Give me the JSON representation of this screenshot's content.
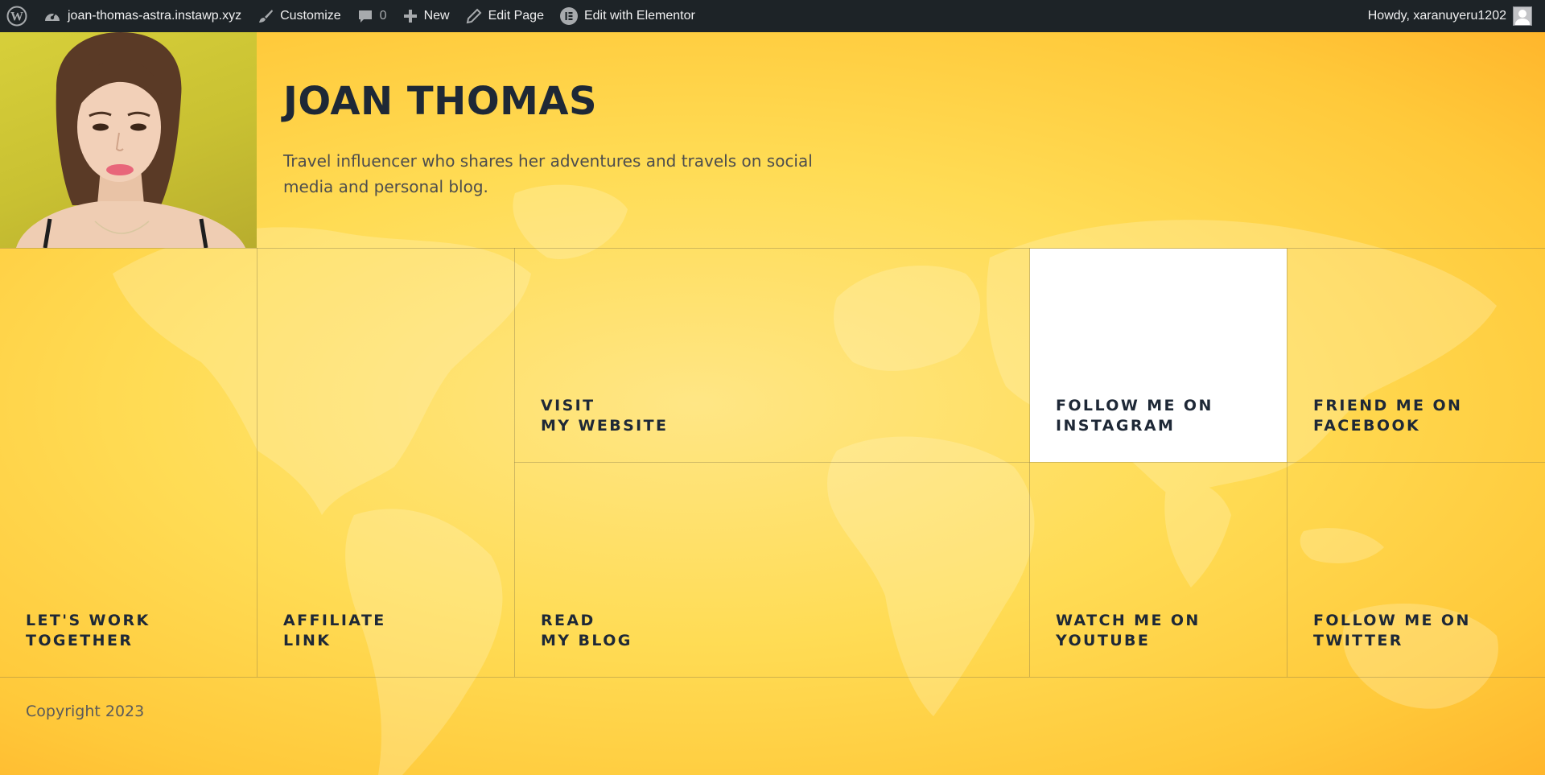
{
  "adminbar": {
    "site_name": "joan-thomas-astra.instawp.xyz",
    "customize": "Customize",
    "comments_count": "0",
    "new": "New",
    "edit_page": "Edit Page",
    "edit_elementor": "Edit with Elementor",
    "howdy": "Howdy, xaranuyeru1202"
  },
  "header": {
    "title": "JOAN THOMAS",
    "tagline": "Travel influencer who shares her adventures and travels on social media and personal blog."
  },
  "tiles": [
    {
      "line1": "VISIT",
      "line2": "MY WEBSITE"
    },
    {
      "line1": "FOLLOW ME ON",
      "line2": "INSTAGRAM"
    },
    {
      "line1": "FRIEND ME ON",
      "line2": "FACEBOOK"
    },
    {
      "line1": "LET'S WORK",
      "line2": "TOGETHER"
    },
    {
      "line1": "AFFILIATE",
      "line2": "LINK"
    },
    {
      "line1": "READ",
      "line2": "MY BLOG"
    },
    {
      "line1": "WATCH ME ON",
      "line2": "YOUTUBE"
    },
    {
      "line1": "FOLLOW ME ON",
      "line2": "TWITTER"
    }
  ],
  "footer": {
    "copyright": "Copyright 2023"
  },
  "colors": {
    "admin_bar": "#1d2327",
    "background_yellow": "#ffdc55",
    "text_dark": "#1e2836",
    "highlight_tile": "#ffffff"
  }
}
